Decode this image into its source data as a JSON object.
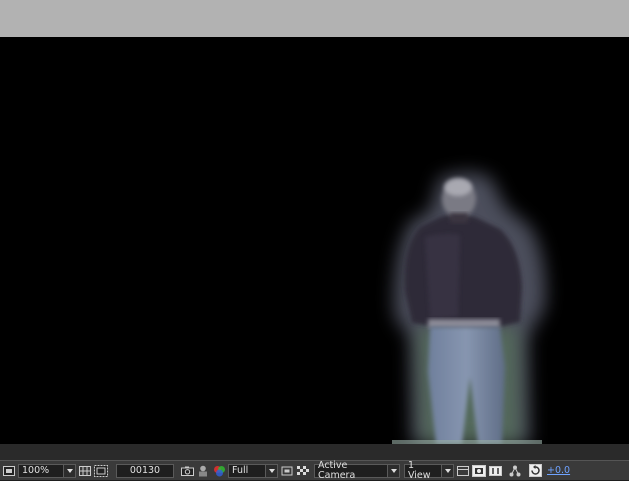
{
  "viewer": {
    "background": "#000000",
    "pasteboard": "#b2b2b2"
  },
  "footer": {
    "magnification": "100%",
    "timecode": "00130",
    "resolution": "Full",
    "camera_view": "Active Camera",
    "view_layout": "1 View",
    "exposure": "+0.0"
  },
  "icons": [
    "always-preview-icon",
    "grid-guides-icon",
    "mask-visibility-icon",
    "snapshot-icon",
    "show-snapshot-icon",
    "color-channels-icon",
    "region-of-interest-icon",
    "transparency-grid-icon",
    "draft-3d-icon",
    "fast-previews-icon",
    "timeline-icon",
    "flowchart-icon",
    "reset-exposure-icon"
  ]
}
